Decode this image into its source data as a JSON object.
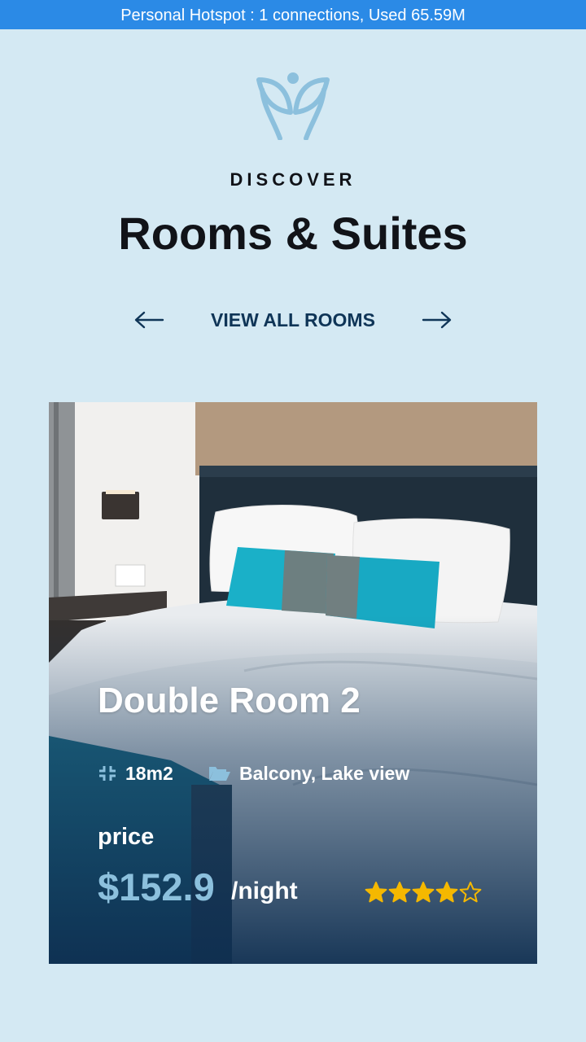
{
  "status_bar": {
    "text": "Personal Hotspot : 1 connections, Used 65.59M"
  },
  "header": {
    "logo_icon": "leaf-person-logo-icon",
    "eyebrow": "DISCOVER",
    "title": "Rooms & Suites"
  },
  "nav": {
    "prev_icon": "arrow-left-icon",
    "view_all_label": "VIEW ALL ROOMS",
    "next_icon": "arrow-right-icon"
  },
  "room": {
    "image": "hotel-bedroom-photo",
    "title": "Double Room 2",
    "size_icon": "expand-icon",
    "size": "18m2",
    "view_icon": "folder-open-icon",
    "view": "Balcony, Lake view",
    "price_label": "price",
    "price": "$152.9",
    "per_night": "/night",
    "rating": 4.5,
    "rating_max": 5
  },
  "colors": {
    "background": "#d4e9f3",
    "status_bar": "#2b8ae6",
    "accent": "#8cc0dd",
    "star": "#f5b800",
    "nav_text": "#0f3557"
  }
}
